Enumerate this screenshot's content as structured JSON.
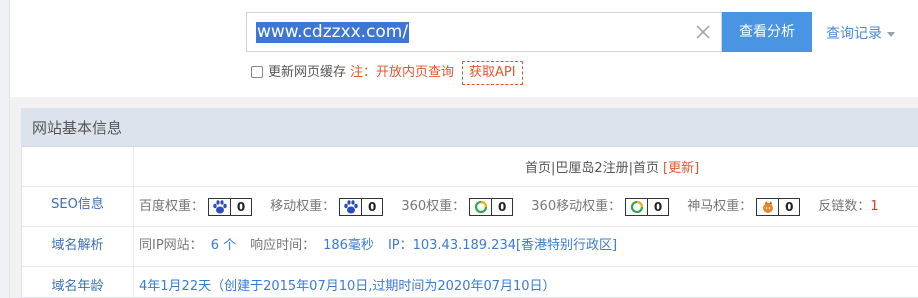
{
  "search": {
    "value": "www.cdzzxx.com/",
    "button_label": "查看分析",
    "history_label": "查询记录"
  },
  "options": {
    "cache_label": "更新网页缓存",
    "note": "注：开放内页查询",
    "api_label": "获取API"
  },
  "panel": {
    "title": "网站基本信息",
    "url_info": "首页|巴厘岛2注册|首页",
    "update_label": "[更新]",
    "seo": {
      "label": "SEO信息",
      "baidu_label": "百度权重：",
      "baidu_value": "0",
      "mobile_label": "移动权重：",
      "mobile_value": "0",
      "s360_label": "360权重：",
      "s360_value": "0",
      "s360_mobile_label": "360移动权重：",
      "s360_mobile_value": "0",
      "shenma_label": "神马权重：",
      "shenma_value": "0",
      "backlinks_label": "反链数：",
      "backlinks_value": "1"
    },
    "domain": {
      "label": "域名解析",
      "same_ip_label": "同IP网站：",
      "same_ip_value": "6 个",
      "response_label": "响应时间：",
      "response_value": "186毫秒",
      "ip_text": "IP：103.43.189.234[香港特别行政区]"
    },
    "age": {
      "label": "域名年龄",
      "value": "4年1月22天（创建于2015年07月10日,过期时间为2020年07月10日）"
    }
  },
  "colors": {
    "accent": "#4a95e3",
    "highlight": "#e4572e",
    "link": "#3a7bd5"
  }
}
